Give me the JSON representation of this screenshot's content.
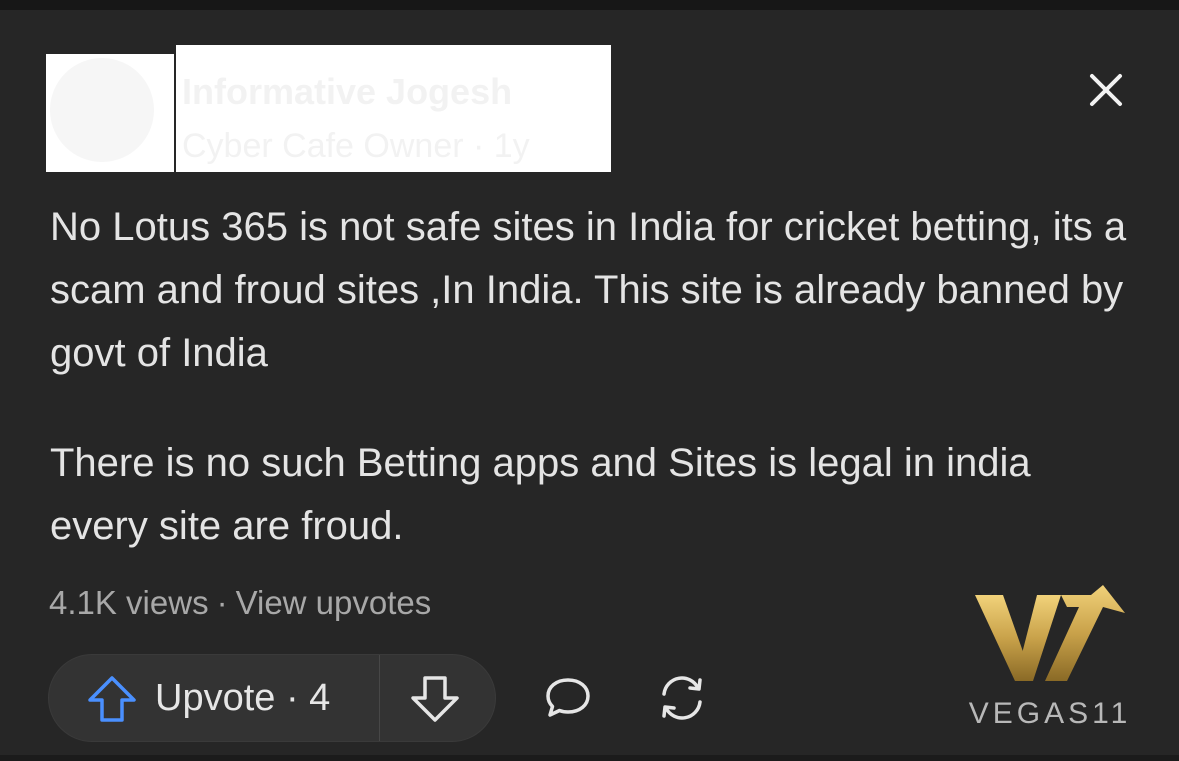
{
  "post": {
    "author_name": "Informative Jogesh",
    "author_meta": "Cyber Cafe Owner · 1y",
    "paragraphs": [
      "No Lotus 365 is not safe sites in India for cricket betting, its a scam and froud sites ,In India. This site is already banned by govt of India",
      "There is no such Betting apps and Sites is legal in india every site are froud."
    ],
    "views": "4.1K views",
    "separator": "·",
    "view_upvotes": "View upvotes"
  },
  "actions": {
    "upvote_label": "Upvote · 4",
    "upvote_icon": "arrow-up-icon",
    "downvote_icon": "arrow-down-icon",
    "comment_icon": "comment-bubble-icon",
    "share_icon": "refresh-share-icon",
    "close_icon": "close-icon"
  },
  "watermark": {
    "text": "VEGAS11"
  },
  "colors": {
    "background": "#262626",
    "text_primary": "#e4e4e4",
    "text_secondary": "#a8a8a8",
    "upvote_accent": "#4a90ff",
    "pill_background": "#333333",
    "logo_gold": "#c9a24a"
  }
}
